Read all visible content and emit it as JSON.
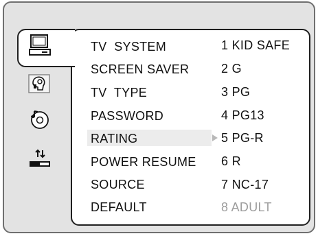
{
  "colors": {
    "frame_bg": "#e3e3e3",
    "panel_bg": "#ffffff",
    "highlight": "#ececec",
    "disabled_text": "#9c9c9c",
    "text": "#111111"
  },
  "sidebar": {
    "icons": [
      {
        "name": "general-setup-icon",
        "selected": true
      },
      {
        "name": "speaker-setup-icon",
        "selected": false
      },
      {
        "name": "audio-setup-icon",
        "selected": false
      },
      {
        "name": "preference-setup-icon",
        "selected": false
      }
    ]
  },
  "menu": {
    "items": [
      {
        "label": "TV  SYSTEM"
      },
      {
        "label": "SCREEN SAVER"
      },
      {
        "label": "TV  TYPE"
      },
      {
        "label": "PASSWORD"
      },
      {
        "label": "RATING"
      },
      {
        "label": "POWER RESUME"
      },
      {
        "label": "SOURCE"
      },
      {
        "label": "DEFAULT"
      }
    ],
    "highlighted_index": 4
  },
  "options": {
    "items": [
      {
        "label": "1 KID SAFE",
        "enabled": true
      },
      {
        "label": "2 G",
        "enabled": true
      },
      {
        "label": "3 PG",
        "enabled": true
      },
      {
        "label": "4 PG13",
        "enabled": true
      },
      {
        "label": "5 PG-R",
        "enabled": true
      },
      {
        "label": "6 R",
        "enabled": true
      },
      {
        "label": "7 NC-17",
        "enabled": true
      },
      {
        "label": "8 ADULT",
        "enabled": false
      }
    ],
    "pointer_index": 4
  }
}
